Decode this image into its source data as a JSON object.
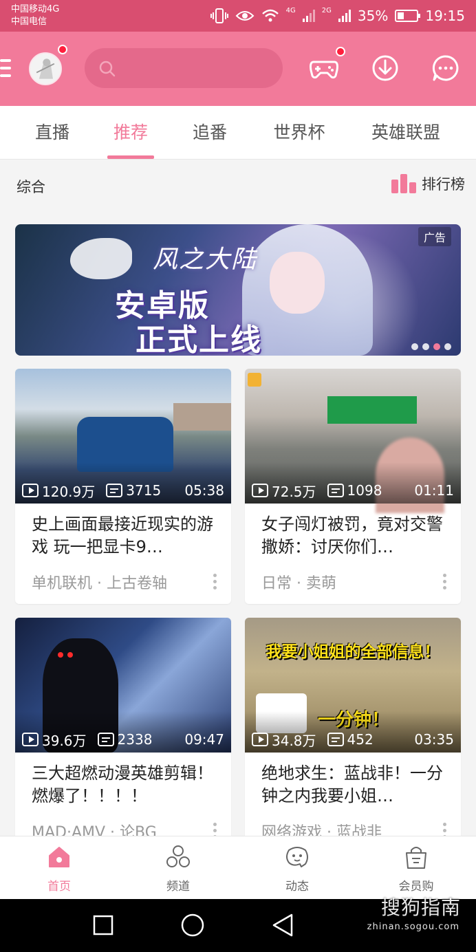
{
  "status_bar": {
    "carrier_1": "中国移动4G",
    "carrier_2": "中国电信",
    "net_1": "4G",
    "net_2": "2G",
    "battery": "35%",
    "battery_level": 0.35,
    "time": "19:15"
  },
  "header": {
    "search_placeholder": ""
  },
  "tabs": [
    {
      "label": "直播"
    },
    {
      "label": "推荐"
    },
    {
      "label": "追番"
    },
    {
      "label": "世界杯"
    },
    {
      "label": "英雄联盟"
    }
  ],
  "active_tab": "推荐",
  "section": {
    "title": "综合",
    "ranking_label": "排行榜"
  },
  "banner": {
    "logo_text": "风之大陆",
    "line1": "安卓版",
    "line2": "正式上线",
    "ad_label": "广告",
    "slide_count": 4,
    "active_slide": 3
  },
  "videos": [
    {
      "views": "120.9万",
      "danmaku": "3715",
      "duration": "05:38",
      "title": "史上画面最接近现实的游戏 玩一把显卡9…",
      "tags": "单机联机 · 上古卷轴"
    },
    {
      "views": "72.5万",
      "danmaku": "1098",
      "duration": "01:11",
      "title": "女子闯灯被罚，竟对交警撒娇：讨厌你们…",
      "tags": "日常 · 卖萌"
    },
    {
      "views": "39.6万",
      "danmaku": "2338",
      "duration": "09:47",
      "title": "三大超燃动漫英雄剪辑！燃爆了！！！！",
      "tags": "MAD·AMV · 论BG"
    },
    {
      "views": "34.8万",
      "danmaku": "452",
      "duration": "03:35",
      "title": "绝地求生：蓝战非！一分钟之内我要小姐…",
      "tags": "网络游戏 · 蓝战非",
      "overlay_1": "我要小姐姐的全部信息！",
      "overlay_2": "一分钟！"
    }
  ],
  "bottom_nav": [
    {
      "label": "首页",
      "icon": "home-icon"
    },
    {
      "label": "频道",
      "icon": "channel-icon"
    },
    {
      "label": "动态",
      "icon": "dynamic-icon"
    },
    {
      "label": "会员购",
      "icon": "shop-bag-icon"
    }
  ],
  "watermark": {
    "main": "搜狗指南",
    "sub": "zhinan.sogou.com"
  },
  "colors": {
    "brand_pink": "#f27a9a",
    "status_bar": "#d94e70",
    "notification_red": "#ff1f3d"
  }
}
